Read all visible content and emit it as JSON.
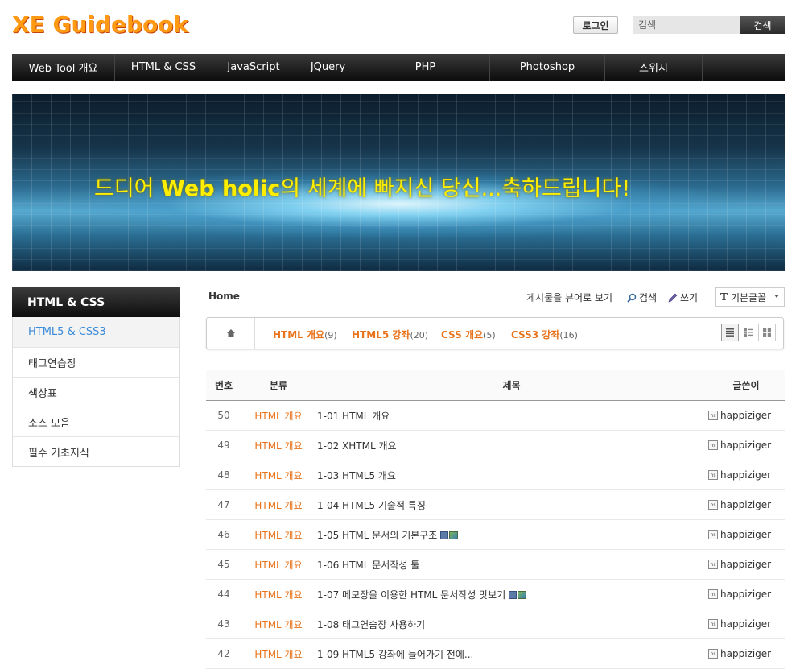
{
  "header": {
    "logo": "XE Guidebook",
    "login_label": "로그인",
    "search_placeholder": "검색",
    "search_button": "검색"
  },
  "nav": [
    {
      "label": "Web Tool 개요"
    },
    {
      "label": "HTML & CSS"
    },
    {
      "label": "JavaScript"
    },
    {
      "label": "JQuery"
    },
    {
      "label": "PHP"
    },
    {
      "label": "Photoshop"
    },
    {
      "label": "스위시"
    },
    {
      "label": ""
    }
  ],
  "banner": {
    "text_pre": "드디어 ",
    "text_bold": "Web holic",
    "text_post": "의 세계에 빠지신 당신...축하드립니다!"
  },
  "sidebar": {
    "title": "HTML & CSS",
    "items": [
      {
        "label": "HTML5 & CSS3",
        "active": true
      },
      {
        "label": "태그연습장"
      },
      {
        "label": "색상표"
      },
      {
        "label": "소스 모음"
      },
      {
        "label": "필수 기초지식"
      }
    ]
  },
  "board": {
    "home": "Home",
    "view_list": "게시물을 뷰어로 보기",
    "search": "검색",
    "write": "쓰기",
    "font_select": "기본글꼴",
    "categories": [
      {
        "name": "HTML 개요",
        "count": "(9)"
      },
      {
        "name": "HTML5 강좌",
        "count": "(20)"
      },
      {
        "name": "CSS 개요",
        "count": "(5)"
      },
      {
        "name": "CSS3 강좌",
        "count": "(16)"
      }
    ],
    "columns": {
      "no": "번호",
      "cat": "분류",
      "title": "제목",
      "author": "글쓴이"
    },
    "rows": [
      {
        "no": "50",
        "cat": "HTML 개요",
        "title": "1-01 HTML 개요",
        "author": "happiziger",
        "files": false
      },
      {
        "no": "49",
        "cat": "HTML 개요",
        "title": "1-02 XHTML 개요",
        "author": "happiziger",
        "files": false
      },
      {
        "no": "48",
        "cat": "HTML 개요",
        "title": "1-03 HTML5 개요",
        "author": "happiziger",
        "files": false
      },
      {
        "no": "47",
        "cat": "HTML 개요",
        "title": "1-04 HTML5 기술적 특징",
        "author": "happiziger",
        "files": false
      },
      {
        "no": "46",
        "cat": "HTML 개요",
        "title": "1-05 HTML 문서의 기본구조",
        "author": "happiziger",
        "files": true
      },
      {
        "no": "45",
        "cat": "HTML 개요",
        "title": "1-06 HTML 문서작성 툴",
        "author": "happiziger",
        "files": false
      },
      {
        "no": "44",
        "cat": "HTML 개요",
        "title": "1-07 메모장을 이용한 HTML 문서작성 맛보기",
        "author": "happiziger",
        "files": true
      },
      {
        "no": "43",
        "cat": "HTML 개요",
        "title": "1-08 태그연습장 사용하기",
        "author": "happiziger",
        "files": false
      },
      {
        "no": "42",
        "cat": "HTML 개요",
        "title": "1-09 HTML5 강좌에 들어가기 전에...",
        "author": "happiziger",
        "files": false
      }
    ]
  }
}
